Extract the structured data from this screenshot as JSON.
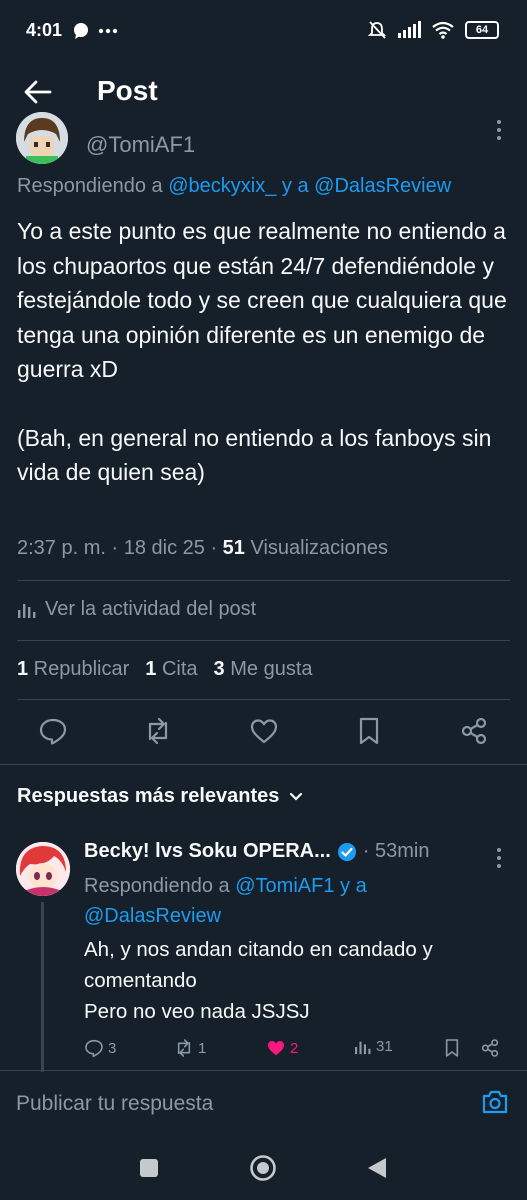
{
  "status_bar": {
    "time": "4:01",
    "battery": "64"
  },
  "header": {
    "title": "Post"
  },
  "tweet": {
    "handle": "@TomiAF1",
    "reply_prefix": "Respondiendo a ",
    "reply_user1": "@beckyxix_",
    "reply_and": " y a ",
    "reply_user2": "@DalasReview",
    "text_p1": "Yo a este punto es que realmente no entiendo a los chupaortos que están 24/7 defendiéndole y festejándole todo y se creen que cualquiera que tenga una opinión diferente es un enemigo de guerra xD",
    "text_p2": "(Bah, en general no entiendo a los fanboys sin vida de quien sea)",
    "time": "2:37 p. m. · 18 dic 25 · ",
    "views_count": "51",
    "views_label": " Visualizaciones",
    "activity_label": "Ver la actividad del post",
    "reposts_count": "1",
    "reposts_label": " Republicar",
    "quotes_count": "1",
    "quotes_label": " Cita",
    "likes_count": "3",
    "likes_label": " Me gusta"
  },
  "replies_section": {
    "label": "Respuestas más relevantes"
  },
  "reply": {
    "name": "Becky! lvs Soku OPERA...",
    "time": "· 53min",
    "reply_prefix": "Respondiendo a ",
    "reply_user1": "@TomiAF1",
    "reply_and": " y a",
    "reply_user2": "@DalasReview",
    "text_line1": "Ah, y nos andan citando en candado y comentando",
    "text_line2": "Pero no veo nada JSJSJ",
    "replies": "3",
    "reposts": "1",
    "likes": "2",
    "views": "31"
  },
  "compose": {
    "placeholder": "Publicar tu respuesta"
  },
  "colors": {
    "background": "#15202b",
    "accent": "#1d9bf0",
    "muted": "#8b98a5",
    "like": "#f91880"
  }
}
